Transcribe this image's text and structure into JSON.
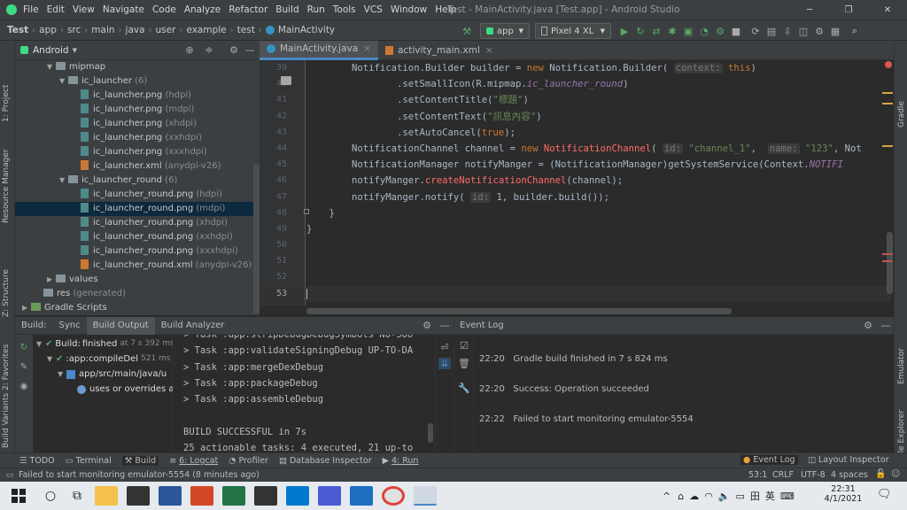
{
  "titlebar": {
    "menu": [
      "File",
      "Edit",
      "View",
      "Navigate",
      "Code",
      "Analyze",
      "Refactor",
      "Build",
      "Run",
      "Tools",
      "VCS",
      "Window",
      "Help"
    ],
    "title": "Test - MainActivity.java [Test.app] - Android Studio",
    "min": "─",
    "max": "❐",
    "close": "✕"
  },
  "breadcrumb": [
    "Test",
    "app",
    "src",
    "main",
    "java",
    "user",
    "example",
    "test",
    "MainActivity"
  ],
  "toolbar": {
    "config": "app",
    "device": "Pixel 4 XL"
  },
  "project": {
    "view": "Android",
    "tree": [
      {
        "indent": 2,
        "type": "folder",
        "open": true,
        "label": "mipmap",
        "extra": ""
      },
      {
        "indent": 3,
        "type": "folder",
        "open": true,
        "label": "ic_launcher",
        "extra": "(6)"
      },
      {
        "indent": 4,
        "type": "png",
        "label": "ic_launcher.png",
        "extra": "(hdpi)"
      },
      {
        "indent": 4,
        "type": "png",
        "label": "ic_launcher.png",
        "extra": "(mdpi)"
      },
      {
        "indent": 4,
        "type": "png",
        "label": "ic_launcher.png",
        "extra": "(xhdpi)"
      },
      {
        "indent": 4,
        "type": "png",
        "label": "ic_launcher.png",
        "extra": "(xxhdpi)"
      },
      {
        "indent": 4,
        "type": "png",
        "label": "ic_launcher.png",
        "extra": "(xxxhdpi)"
      },
      {
        "indent": 4,
        "type": "xml",
        "label": "ic_launcher.xml",
        "extra": "(anydpi-v26)"
      },
      {
        "indent": 3,
        "type": "folder",
        "open": true,
        "label": "ic_launcher_round",
        "extra": "(6)"
      },
      {
        "indent": 4,
        "type": "png",
        "label": "ic_launcher_round.png",
        "extra": "(hdpi)"
      },
      {
        "indent": 4,
        "type": "png",
        "label": "ic_launcher_round.png",
        "extra": "(mdpi)",
        "selected": true
      },
      {
        "indent": 4,
        "type": "png",
        "label": "ic_launcher_round.png",
        "extra": "(xhdpi)"
      },
      {
        "indent": 4,
        "type": "png",
        "label": "ic_launcher_round.png",
        "extra": "(xxhdpi)"
      },
      {
        "indent": 4,
        "type": "png",
        "label": "ic_launcher_round.png",
        "extra": "(xxxhdpi)"
      },
      {
        "indent": 4,
        "type": "xml",
        "label": "ic_launcher_round.xml",
        "extra": "(anydpi-v26)"
      },
      {
        "indent": 2,
        "type": "folder",
        "open": false,
        "label": "values",
        "extra": ""
      },
      {
        "indent": 1,
        "type": "folder",
        "open": null,
        "label": "res",
        "extra": "(generated)"
      },
      {
        "indent": 0,
        "type": "gradle",
        "open": false,
        "label": "Gradle Scripts",
        "extra": ""
      }
    ]
  },
  "editor": {
    "tabs": [
      "MainActivity.java",
      "activity_main.xml"
    ],
    "lines": [
      "39",
      "40",
      "41",
      "42",
      "43",
      "44",
      "45",
      "46",
      "47",
      "48",
      "49",
      "50",
      "51",
      "52",
      "53"
    ]
  },
  "sidetabs": {
    "left": [
      "1: Project",
      "Resource Manager",
      "Z: Structure",
      "2: Favorites",
      "Build Variants"
    ],
    "right": [
      "Gradle",
      "Emulator",
      "Device File Explorer"
    ]
  },
  "build": {
    "tabs": [
      "Build:",
      "Sync",
      "Build Output",
      "Build Analyzer"
    ],
    "tree": [
      {
        "label": "Build:",
        "bold": "finished",
        "extra": "at 7 s 392 ms"
      },
      {
        "label": ":app:compileDel",
        "extra": "521 ms"
      },
      {
        "label": "app/src/main/java/u",
        "extra": ""
      },
      {
        "label": "uses or overrides a",
        "extra": ""
      }
    ],
    "console": [
      "> Task :app:stripDebugDebugSymbols NO-SOU",
      "> Task :app:validateSigningDebug UP-TO-DA",
      "> Task :app:mergeDexDebug",
      "> Task :app:packageDebug",
      "> Task :app:assembleDebug",
      "",
      "BUILD SUCCESSFUL in 7s",
      "25 actionable tasks: 4 executed, 21 up-to"
    ]
  },
  "eventlog": {
    "title": "Event Log",
    "events": [
      {
        "time": "22:20",
        "msg": "Gradle build finished in 7 s 824 ms"
      },
      {
        "time": "22:20",
        "msg": "Success: Operation succeeded"
      },
      {
        "time": "22:22",
        "msg": "Failed to start monitoring emulator-5554"
      }
    ]
  },
  "bottomtools": [
    "TODO",
    "Terminal",
    "Build",
    "6: Logcat",
    "Profiler",
    "Database Inspector",
    "4: Run"
  ],
  "bottomright": [
    "Event Log",
    "Layout Inspector"
  ],
  "status": {
    "message": "Failed to start monitoring emulator-5554 (8 minutes ago)",
    "pos": "53:1",
    "eol": "CRLF",
    "enc": "UTF-8",
    "indent": "4 spaces"
  },
  "taskbar": {
    "ime": "英",
    "time": "22:31",
    "date": "4/1/2021"
  }
}
